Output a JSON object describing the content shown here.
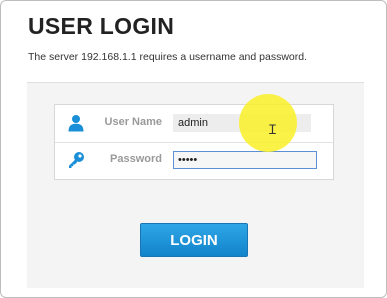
{
  "dialog": {
    "title": "USER LOGIN",
    "message": "The server 192.168.1.1 requires a username and password."
  },
  "form": {
    "username": {
      "label": "User Name",
      "value": "admin",
      "icon": "user-icon"
    },
    "password": {
      "label": "Password",
      "value": "•••••",
      "icon": "key-icon"
    }
  },
  "actions": {
    "login_label": "LOGIN"
  },
  "colors": {
    "accent": "#1a8fd8",
    "icon": "#1a8fd8",
    "highlight": "#f7ec1e"
  }
}
